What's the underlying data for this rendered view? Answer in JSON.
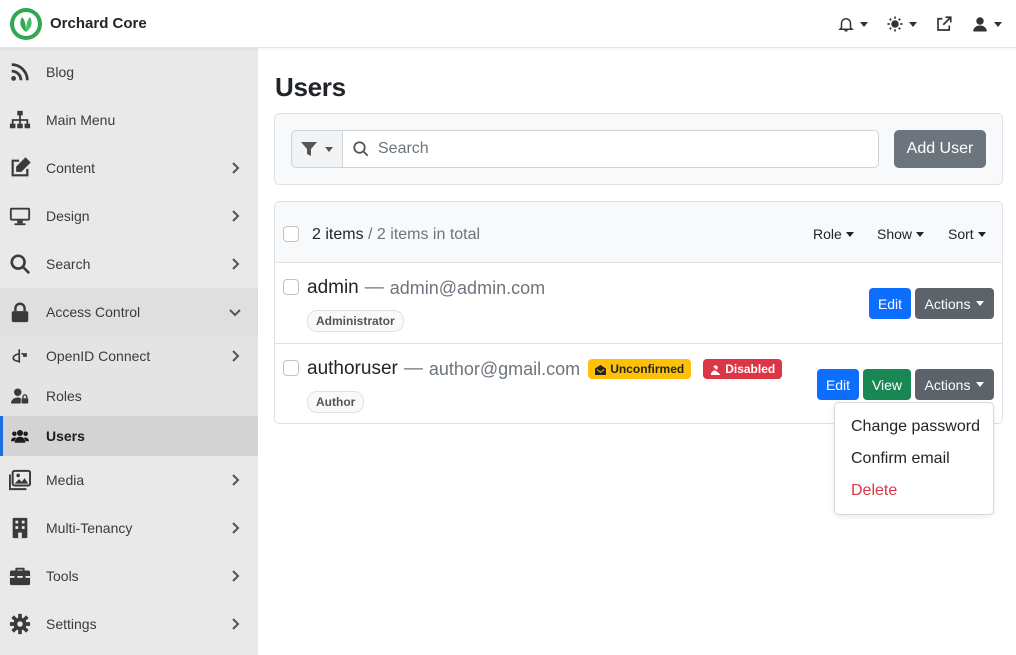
{
  "app": {
    "name": "Orchard Core"
  },
  "topbar": {
    "icons": [
      "bell-icon",
      "theme-icon",
      "external-link-icon",
      "user-icon"
    ]
  },
  "sidebar": {
    "items": [
      {
        "label": "Blog",
        "icon": "rss-icon"
      },
      {
        "label": "Main Menu",
        "icon": "sitemap-icon"
      },
      {
        "label": "Content",
        "icon": "edit-icon"
      },
      {
        "label": "Design",
        "icon": "desktop-icon"
      },
      {
        "label": "Search",
        "icon": "search-icon"
      },
      {
        "label": "Access Control",
        "icon": "lock-icon"
      },
      {
        "label": "OpenID Connect",
        "icon": "openid-icon"
      },
      {
        "label": "Roles",
        "icon": "user-lock-icon"
      },
      {
        "label": "Users",
        "icon": "users-icon"
      },
      {
        "label": "Media",
        "icon": "images-icon"
      },
      {
        "label": "Multi-Tenancy",
        "icon": "building-icon"
      },
      {
        "label": "Tools",
        "icon": "toolbox-icon"
      },
      {
        "label": "Settings",
        "icon": "cog-icon"
      }
    ]
  },
  "page": {
    "title": "Users"
  },
  "filter": {
    "search_placeholder": "Search",
    "add_user_label": "Add User"
  },
  "list": {
    "count_main": "2 items",
    "count_total": " / 2 items in total",
    "role_label": "Role",
    "show_label": "Show",
    "sort_label": "Sort",
    "users": [
      {
        "name": "admin",
        "separator": "—",
        "email": "admin@admin.com",
        "role": "Administrator",
        "edit": "Edit",
        "actions": "Actions"
      },
      {
        "name": "authoruser",
        "separator": "—",
        "email": "author@gmail.com",
        "role": "Author",
        "badge_unconfirmed": "Unconfirmed",
        "badge_disabled": "Disabled",
        "edit": "Edit",
        "view": "View",
        "actions": "Actions"
      }
    ]
  },
  "actions_menu": {
    "items": [
      "Change password",
      "Confirm email",
      "Delete"
    ]
  },
  "colors": {
    "primary": "#0d6efd",
    "success": "#198754",
    "secondary": "#5c636a",
    "warning": "#ffc107",
    "danger": "#dc3545",
    "brand": "#2fa84f"
  }
}
